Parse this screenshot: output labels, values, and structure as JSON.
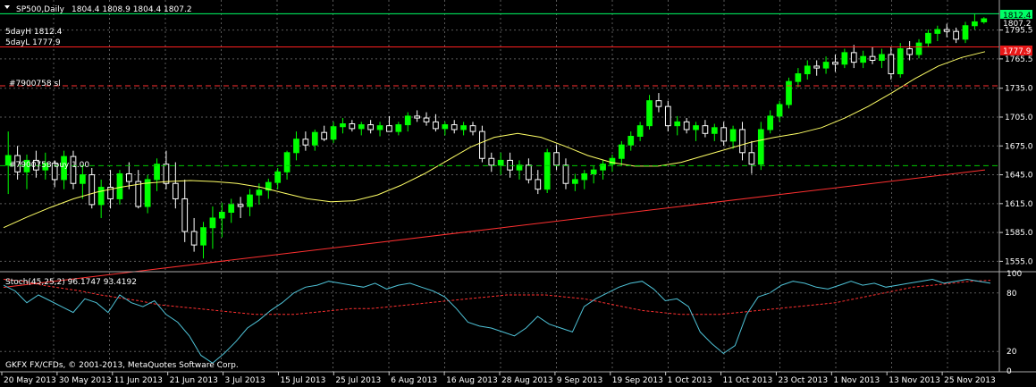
{
  "header": {
    "symbol": "SP500,Daily",
    "ohlc": "1804.4 1808.9 1804.4 1807.2",
    "day_high": "5dayH 1812.4",
    "day_low": "5dayL 1777.9",
    "sl_label": "#7900758 sl",
    "buy_label": "#7900758 buy 1.00"
  },
  "stoch": {
    "label": "Stoch(45,25,2) 96.1747 93.4192",
    "levels": [
      "100",
      "80",
      "20",
      "0"
    ]
  },
  "footer": {
    "copyright": "GKFX FX/CFDs, © 2001-2013, MetaQuotes Software Corp."
  },
  "price_badges": {
    "high": "1812.4",
    "current": "1807.2",
    "low": "1777.9"
  },
  "colors": {
    "background": "#000000",
    "grid": "#5a5a5a",
    "bull": "#00ff00",
    "bear": "#ffffff",
    "ma": "#ffff66",
    "trend": "#ff3030",
    "high_line": "#00ff66",
    "low_line": "#ff2020",
    "sl_line": "#ff3030",
    "buy_line": "#00cc00",
    "stoch_main": "#4fc3d8",
    "stoch_signal": "#ff3030"
  },
  "chart_data": [
    {
      "type": "candlestick",
      "symbol": "SP500",
      "timeframe": "Daily",
      "ylim": [
        1547,
        1823
      ],
      "y_ticks": [
        1555.0,
        1585.0,
        1615.0,
        1645.0,
        1675.0,
        1705.0,
        1735.0,
        1765.5,
        1795.5
      ],
      "x_tick_labels": [
        "20 May 2013",
        "30 May 2013",
        "11 Jun 2013",
        "21 Jun 2013",
        "3 Jul 2013",
        "15 Jul 2013",
        "25 Jul 2013",
        "6 Aug 2013",
        "16 Aug 2013",
        "28 Aug 2013",
        "9 Sep 2013",
        "19 Sep 2013",
        "1 Oct 2013",
        "11 Oct 2013",
        "23 Oct 2013",
        "1 Nov 2013",
        "13 Nov 2013",
        "25 Nov 2013"
      ],
      "candles_ohlc": [
        [
          1655,
          1690,
          1625,
          1665
        ],
        [
          1665,
          1675,
          1640,
          1648
        ],
        [
          1648,
          1666,
          1630,
          1660
        ],
        [
          1660,
          1670,
          1642,
          1650
        ],
        [
          1650,
          1668,
          1640,
          1657
        ],
        [
          1657,
          1660,
          1632,
          1640
        ],
        [
          1640,
          1670,
          1630,
          1664
        ],
        [
          1664,
          1670,
          1630,
          1636
        ],
        [
          1636,
          1655,
          1620,
          1645
        ],
        [
          1645,
          1652,
          1610,
          1614
        ],
        [
          1614,
          1640,
          1600,
          1632
        ],
        [
          1632,
          1650,
          1610,
          1620
        ],
        [
          1620,
          1650,
          1614,
          1646
        ],
        [
          1646,
          1658,
          1630,
          1638
        ],
        [
          1638,
          1650,
          1610,
          1612
        ],
        [
          1612,
          1645,
          1605,
          1640
        ],
        [
          1640,
          1662,
          1628,
          1656
        ],
        [
          1656,
          1670,
          1630,
          1636
        ],
        [
          1636,
          1658,
          1610,
          1620
        ],
        [
          1620,
          1640,
          1575,
          1586
        ],
        [
          1586,
          1600,
          1565,
          1572
        ],
        [
          1572,
          1596,
          1558,
          1590
        ],
        [
          1590,
          1612,
          1568,
          1600
        ],
        [
          1600,
          1616,
          1580,
          1606
        ],
        [
          1606,
          1620,
          1595,
          1614
        ],
        [
          1614,
          1622,
          1600,
          1612
        ],
        [
          1612,
          1630,
          1602,
          1624
        ],
        [
          1624,
          1636,
          1614,
          1629
        ],
        [
          1629,
          1641,
          1620,
          1637
        ],
        [
          1637,
          1652,
          1630,
          1648
        ],
        [
          1648,
          1670,
          1640,
          1668
        ],
        [
          1668,
          1690,
          1660,
          1682
        ],
        [
          1682,
          1690,
          1670,
          1676
        ],
        [
          1676,
          1692,
          1670,
          1689
        ],
        [
          1689,
          1696,
          1680,
          1682
        ],
        [
          1682,
          1700,
          1678,
          1695
        ],
        [
          1695,
          1704,
          1688,
          1698
        ],
        [
          1698,
          1702,
          1690,
          1693
        ],
        [
          1693,
          1700,
          1686,
          1697
        ],
        [
          1697,
          1702,
          1688,
          1692
        ],
        [
          1692,
          1700,
          1685,
          1696
        ],
        [
          1696,
          1706,
          1690,
          1690
        ],
        [
          1690,
          1700,
          1686,
          1697
        ],
        [
          1697,
          1710,
          1690,
          1706
        ],
        [
          1706,
          1712,
          1700,
          1704
        ],
        [
          1704,
          1710,
          1696,
          1700
        ],
        [
          1700,
          1708,
          1690,
          1693
        ],
        [
          1693,
          1700,
          1686,
          1697
        ],
        [
          1697,
          1702,
          1688,
          1692
        ],
        [
          1692,
          1700,
          1686,
          1696
        ],
        [
          1696,
          1700,
          1686,
          1690
        ],
        [
          1690,
          1696,
          1658,
          1662
        ],
        [
          1662,
          1668,
          1648,
          1655
        ],
        [
          1655,
          1668,
          1645,
          1660
        ],
        [
          1660,
          1668,
          1642,
          1650
        ],
        [
          1650,
          1660,
          1640,
          1655
        ],
        [
          1655,
          1662,
          1636,
          1640
        ],
        [
          1640,
          1650,
          1625,
          1630
        ],
        [
          1630,
          1672,
          1626,
          1668
        ],
        [
          1668,
          1676,
          1650,
          1655
        ],
        [
          1655,
          1662,
          1630,
          1636
        ],
        [
          1636,
          1646,
          1628,
          1640
        ],
        [
          1640,
          1650,
          1630,
          1646
        ],
        [
          1646,
          1654,
          1636,
          1650
        ],
        [
          1650,
          1660,
          1640,
          1656
        ],
        [
          1656,
          1666,
          1648,
          1662
        ],
        [
          1662,
          1680,
          1655,
          1676
        ],
        [
          1676,
          1690,
          1670,
          1685
        ],
        [
          1685,
          1700,
          1680,
          1696
        ],
        [
          1696,
          1728,
          1692,
          1722
        ],
        [
          1722,
          1730,
          1710,
          1716
        ],
        [
          1716,
          1722,
          1690,
          1696
        ],
        [
          1696,
          1706,
          1686,
          1700
        ],
        [
          1700,
          1704,
          1688,
          1692
        ],
        [
          1692,
          1700,
          1680,
          1696
        ],
        [
          1696,
          1702,
          1684,
          1688
        ],
        [
          1688,
          1698,
          1680,
          1694
        ],
        [
          1694,
          1700,
          1675,
          1680
        ],
        [
          1680,
          1696,
          1672,
          1692
        ],
        [
          1692,
          1700,
          1660,
          1668
        ],
        [
          1668,
          1680,
          1646,
          1656
        ],
        [
          1656,
          1700,
          1650,
          1692
        ],
        [
          1692,
          1712,
          1688,
          1706
        ],
        [
          1706,
          1722,
          1700,
          1718
        ],
        [
          1718,
          1746,
          1714,
          1742
        ],
        [
          1742,
          1756,
          1736,
          1750
        ],
        [
          1750,
          1764,
          1744,
          1758
        ],
        [
          1758,
          1764,
          1748,
          1756
        ],
        [
          1756,
          1768,
          1750,
          1762
        ],
        [
          1762,
          1770,
          1752,
          1760
        ],
        [
          1760,
          1776,
          1756,
          1772
        ],
        [
          1772,
          1780,
          1756,
          1762
        ],
        [
          1762,
          1774,
          1756,
          1768
        ],
        [
          1768,
          1778,
          1760,
          1764
        ],
        [
          1764,
          1776,
          1756,
          1770
        ],
        [
          1770,
          1778,
          1744,
          1750
        ],
        [
          1750,
          1782,
          1746,
          1776
        ],
        [
          1776,
          1784,
          1764,
          1770
        ],
        [
          1770,
          1786,
          1766,
          1782
        ],
        [
          1782,
          1796,
          1778,
          1792
        ],
        [
          1792,
          1800,
          1784,
          1796
        ],
        [
          1796,
          1802,
          1788,
          1794
        ],
        [
          1794,
          1798,
          1782,
          1786
        ],
        [
          1786,
          1804,
          1782,
          1800
        ],
        [
          1800,
          1812,
          1796,
          1804
        ],
        [
          1804,
          1808.9,
          1802,
          1807.2
        ]
      ],
      "moving_average": [
        1590,
        1601,
        1611,
        1620,
        1627,
        1632,
        1636,
        1638,
        1639,
        1638,
        1636,
        1632,
        1626,
        1620,
        1617,
        1618,
        1624,
        1634,
        1646,
        1660,
        1674,
        1684,
        1688,
        1684,
        1675,
        1665,
        1658,
        1654,
        1654,
        1658,
        1665,
        1672,
        1679,
        1684,
        1688,
        1694,
        1704,
        1716,
        1730,
        1745,
        1758,
        1767,
        1773
      ],
      "trend_line": {
        "start": [
          0,
          1528
        ],
        "end": [
          1,
          1650
        ]
      },
      "lines": {
        "high": 1812.4,
        "low": 1777.9,
        "sl": 1737.5,
        "buy": 1654.5
      },
      "stochastic": {
        "ylim": [
          0,
          100
        ],
        "levels": [
          100,
          80,
          20,
          0
        ],
        "main": [
          88,
          82,
          70,
          78,
          72,
          66,
          60,
          74,
          70,
          60,
          78,
          70,
          66,
          72,
          58,
          50,
          36,
          16,
          8,
          18,
          30,
          44,
          52,
          62,
          70,
          80,
          86,
          88,
          92,
          90,
          88,
          86,
          90,
          84,
          88,
          90,
          86,
          82,
          76,
          64,
          50,
          46,
          44,
          40,
          36,
          44,
          56,
          48,
          44,
          40,
          66,
          74,
          80,
          86,
          90,
          92,
          84,
          72,
          74,
          66,
          40,
          28,
          18,
          26,
          58,
          76,
          80,
          88,
          92,
          90,
          86,
          84,
          88,
          92,
          88,
          90,
          86,
          88,
          90,
          92,
          94,
          90,
          92,
          94,
          92,
          90
        ],
        "signal": [
          94,
          92,
          88,
          85,
          82,
          78,
          75,
          72,
          68,
          66,
          64,
          62,
          60,
          58,
          58,
          58,
          60,
          62,
          64,
          64,
          66,
          68,
          70,
          72,
          74,
          76,
          78,
          78,
          78,
          76,
          74,
          70,
          66,
          62,
          60,
          58,
          58,
          58,
          60,
          62,
          64,
          66,
          68,
          70,
          74,
          78,
          82,
          86,
          88,
          90,
          92,
          93
        ]
      }
    }
  ]
}
